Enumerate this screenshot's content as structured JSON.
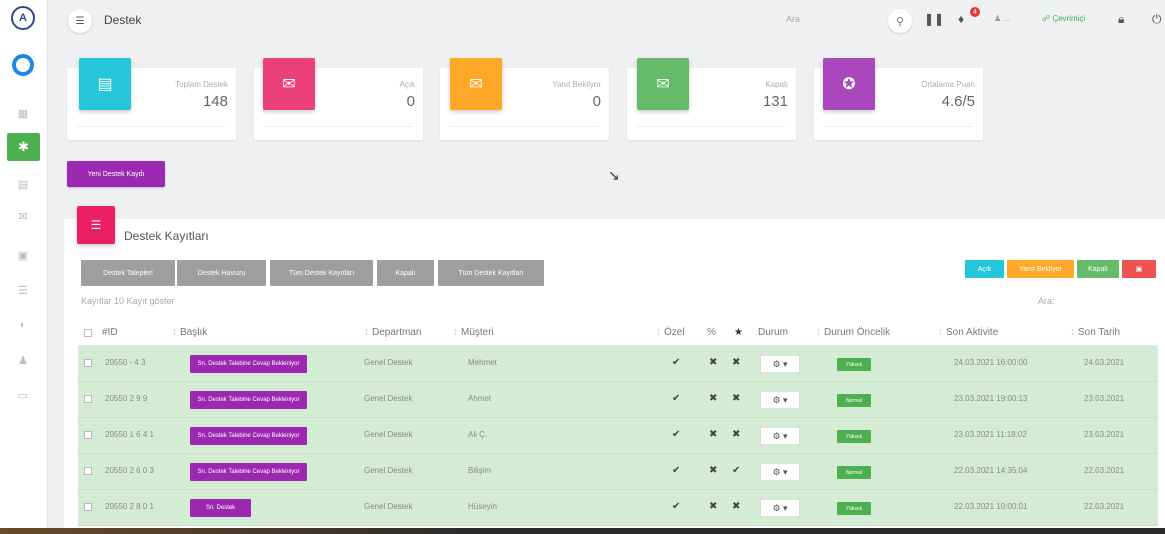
{
  "topbar": {
    "title": "Destek",
    "search": "Ara",
    "notification_count": "4",
    "user_label": "...",
    "online_label": "Çevrimiçi"
  },
  "cards": [
    {
      "label": "Toplam Destek",
      "value": "148",
      "color": "#26c6da",
      "icon": "clipboard-icon"
    },
    {
      "label": "Açık",
      "value": "0",
      "color": "#ec407a",
      "icon": "envelope-open-icon"
    },
    {
      "label": "Yanıt Bekliyor",
      "value": "0",
      "color": "#ffa726",
      "icon": "envelope-icon"
    },
    {
      "label": "Kapalı",
      "value": "131",
      "color": "#66bb6a",
      "icon": "envelope-closed-icon"
    },
    {
      "label": "Ortalama Puan",
      "value": "4.6/5",
      "color": "#ab47bc",
      "icon": "star-icon"
    }
  ],
  "new_button": "Yeni Destek Kaydı",
  "panel": {
    "title": "Destek Kayıtları",
    "tabs": [
      "Destek Talepleri",
      "Destek Havuzu",
      "Tüm Destek Kayıtları",
      "Kapalı",
      "Tüm Destek Kayıtları"
    ],
    "actions": [
      {
        "label": "Açık",
        "color": "#26c6da"
      },
      {
        "label": "Yanıt Bekliyor",
        "color": "#ffa726"
      },
      {
        "label": "Kapalı",
        "color": "#66bb6a"
      },
      {
        "label": "▣",
        "color": "#ef5350"
      }
    ],
    "records_text": "Kayıtlar 10 Kayıt göster",
    "search": "Ara:"
  },
  "table": {
    "headers": [
      "#ID",
      "Başlık",
      "Departman",
      "Müşteri",
      "Özel",
      "%",
      "★",
      "Durum",
      "Durum Öncelik",
      "Son Aktivite",
      "Son Tarih"
    ],
    "rows": [
      {
        "id": "20550 - 4 3",
        "subject": "Sn. Destek Talebine Cevap Bekleniyor",
        "dept": "Genel Destek",
        "customer": "Mehmet",
        "m1": "✔",
        "m2": "✖",
        "m3": "✖",
        "status": "Yüksek",
        "activity": "24.03.2021 16:00:00",
        "date": "24.03.2021"
      },
      {
        "id": "20550 2 9 9",
        "subject": "Sn. Destek Talebine Cevap Bekleniyor",
        "dept": "Genel Destek",
        "customer": "Ahmet",
        "m1": "✔",
        "m2": "✖",
        "m3": "✖",
        "status": "Normal",
        "activity": "23.03.2021 19:00:13",
        "date": "23.03.2021"
      },
      {
        "id": "20550 1 6 4 1",
        "subject": "Sn. Destek Talebine Cevap Bekleniyor",
        "dept": "Genel Destek",
        "customer": "Ali Ç.",
        "m1": "✔",
        "m2": "✖",
        "m3": "✖",
        "status": "Yüksek",
        "activity": "23.03.2021 11:18:02",
        "date": "23.03.2021"
      },
      {
        "id": "20550 2 6 0 3",
        "subject": "Sn. Destek Talebine Cevap Bekleniyor",
        "dept": "Genel Destek",
        "customer": "Bilişim",
        "m1": "✔",
        "m2": "✖",
        "m3": "✔",
        "status": "Normal",
        "activity": "22.03.2021 14:35:04",
        "date": "22.03.2021"
      },
      {
        "id": "20550 2 8 0 1",
        "subject": "Sn. Destek",
        "dept": "Genel Destek",
        "customer": "Hüseyin",
        "m1": "✔",
        "m2": "✖",
        "m3": "✖",
        "status": "Yüksek",
        "activity": "22.03.2021 10:00:01",
        "date": "22.03.2021"
      }
    ]
  },
  "sidebar": {
    "icons": [
      "dashboard-icon",
      "support-icon",
      "chat-icon",
      "mail-icon",
      "image-icon",
      "list-icon",
      "pie-icon",
      "user-icon",
      "box-icon"
    ]
  }
}
